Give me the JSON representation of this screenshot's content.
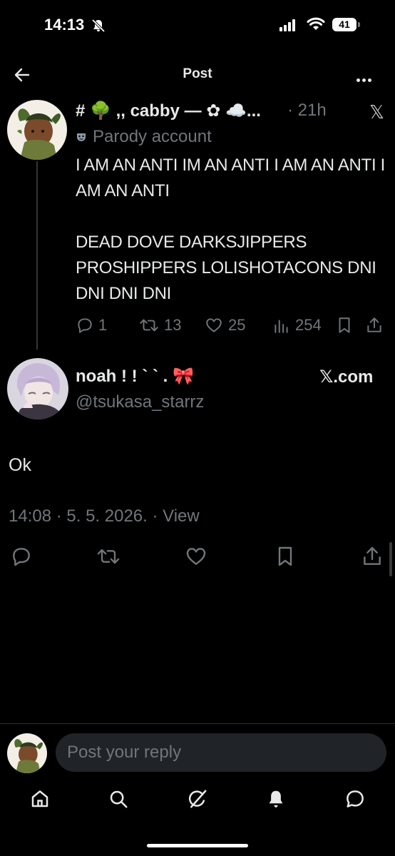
{
  "status_bar": {
    "time": "14:13",
    "battery": "41",
    "icons": [
      "bell-slash-icon",
      "signal-icon",
      "wifi-icon",
      "battery-icon"
    ]
  },
  "header": {
    "title": "Post",
    "icons": [
      "back-arrow-icon",
      "more-icon"
    ]
  },
  "post1": {
    "display_name": "# 🌳 ,, cabby — ✿ ☁️...",
    "time": "· 21h",
    "x_logo": "𝕏",
    "parody_label": "Parody account",
    "text": "I AM AN ANTI IM AN ANTI I AM AN ANTI I AM AN ANTI\n\nDEAD DOVE DARKSJIPPERS PROSHIPPERS LOLISHOTACONS DNI DNI DNI DNI",
    "replies": "1",
    "reposts": "13",
    "likes": "25",
    "views": "254"
  },
  "post2": {
    "display_name": "noah ! ! ` ` . 🎀",
    "handle": "@tsukasa_starrz",
    "source": "𝕏.com",
    "text": "Ok",
    "meta": "14:08 · 5. 5. 2026. · View"
  },
  "reply": {
    "placeholder": "Post your reply"
  },
  "nav": {
    "items": [
      "home-icon",
      "search-icon",
      "grok-icon",
      "notifications-icon",
      "messages-icon"
    ]
  },
  "colors": {
    "background": "#000000",
    "text": "#e7e9ea",
    "muted": "#71767b",
    "input": "#202327"
  }
}
